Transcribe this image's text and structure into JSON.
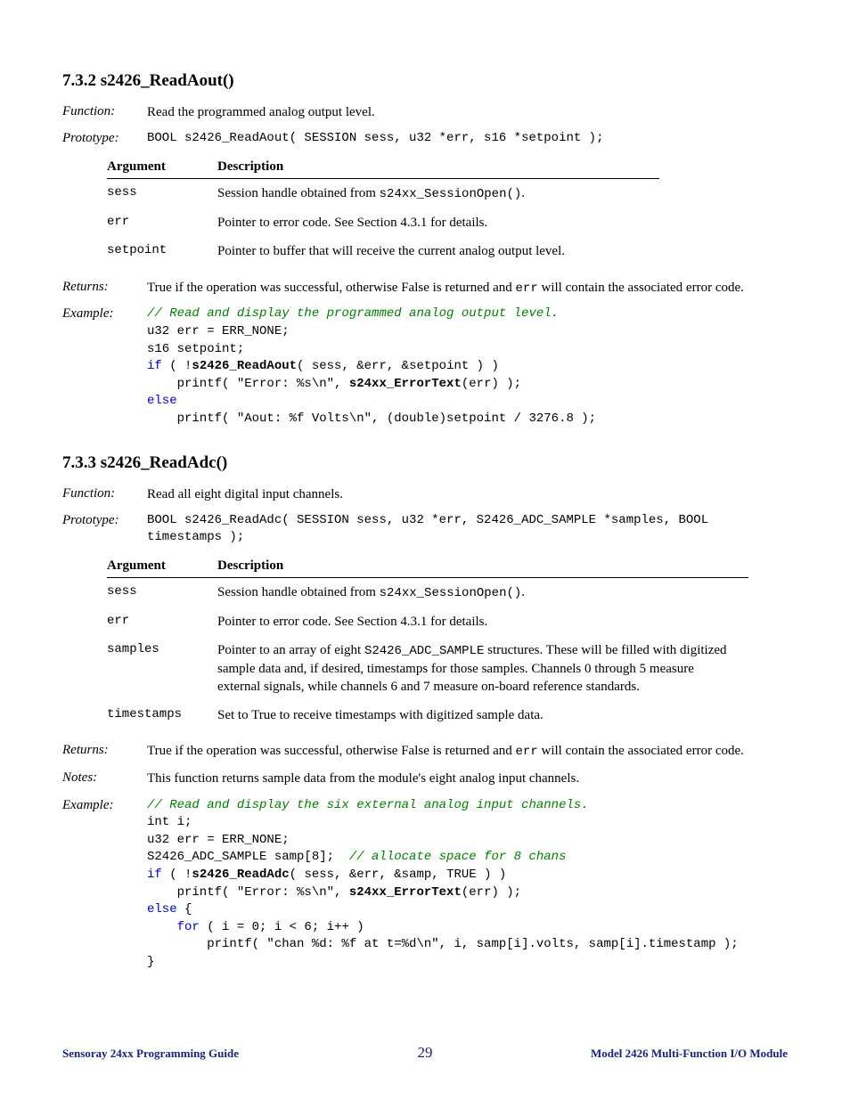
{
  "section732": {
    "heading": "7.3.2  s2426_ReadAout()",
    "function_label": "Function:",
    "function_text": "Read the programmed analog output level.",
    "prototype_label": "Prototype:",
    "prototype_text": "BOOL s2426_ReadAout( SESSION sess, u32 *err, s16 *setpoint );",
    "argtable": {
      "h_arg": "Argument",
      "h_desc": "Description",
      "rows": [
        {
          "arg": "sess",
          "desc_pre": "Session handle obtained from ",
          "desc_code": "s24xx_SessionOpen()",
          "desc_post": "."
        },
        {
          "arg": "err",
          "desc_pre": "Pointer to error code. See Section 4.3.1 for details.",
          "desc_code": "",
          "desc_post": ""
        },
        {
          "arg": "setpoint",
          "desc_pre": "Pointer to buffer that will receive the current analog output level.",
          "desc_code": "",
          "desc_post": ""
        }
      ]
    },
    "returns_label": "Returns:",
    "returns_pre": "True if the operation was successful, otherwise False is returned and ",
    "returns_code": "err",
    "returns_post": " will contain the associated error code.",
    "example_label": "Example:",
    "example": {
      "c1": "// Read and display the programmed analog output level.",
      "l1": "u32 err = ERR_NONE;",
      "l2": "s16 setpoint;",
      "l3_if": "if",
      "l3_rest_a": " ( !",
      "l3_fn": "s2426_ReadAout",
      "l3_rest_b": "( sess, &err, &setpoint ) )",
      "l4_a": "    printf( \"Error: %s\\n\", ",
      "l4_fn": "s24xx_ErrorText",
      "l4_b": "(err) );",
      "l5_else": "else",
      "l6": "    printf( \"Aout: %f Volts\\n\", (double)setpoint / 3276.8 );"
    }
  },
  "section733": {
    "heading": "7.3.3  s2426_ReadAdc()",
    "function_label": "Function:",
    "function_text": "Read all eight digital input channels.",
    "prototype_label": "Prototype:",
    "prototype_text": "BOOL s2426_ReadAdc( SESSION sess, u32 *err, S2426_ADC_SAMPLE *samples, BOOL timestamps );",
    "argtable": {
      "h_arg": "Argument",
      "h_desc": "Description",
      "rows": [
        {
          "arg": "sess",
          "desc_pre": "Session handle obtained from ",
          "desc_code": "s24xx_SessionOpen()",
          "desc_post": "."
        },
        {
          "arg": "err",
          "desc_pre": "Pointer to error code. See Section 4.3.1 for details.",
          "desc_code": "",
          "desc_post": ""
        },
        {
          "arg": "samples",
          "desc_pre": "Pointer to an array of eight ",
          "desc_code": "S2426_ADC_SAMPLE",
          "desc_post": " structures. These will be filled with digitized sample data and, if desired, timestamps for those samples. Channels 0 through 5 measure external signals, while channels 6 and 7 measure on-board reference standards."
        },
        {
          "arg": "timestamps",
          "desc_pre": "Set to True to receive timestamps with digitized sample data.",
          "desc_code": "",
          "desc_post": ""
        }
      ]
    },
    "returns_label": "Returns:",
    "returns_pre": "True if the operation was successful, otherwise False is returned and ",
    "returns_code": "err",
    "returns_post": " will contain the associated error code.",
    "notes_label": "Notes:",
    "notes_text": "This function returns sample data from the module's eight analog input channels.",
    "example_label": "Example:",
    "example": {
      "c1": "// Read and display the six external analog input channels.",
      "l1": "int i;",
      "l2": "u32 err = ERR_NONE;",
      "l3_a": "S2426_ADC_SAMPLE samp[8];  ",
      "l3_c": "// allocate space for 8 chans",
      "l4_if": "if",
      "l4_rest_a": " ( !",
      "l4_fn": "s2426_ReadAdc",
      "l4_rest_b": "( sess, &err, &samp, TRUE ) )",
      "l5_a": "    printf( \"Error: %s\\n\", ",
      "l5_fn": "s24xx_ErrorText",
      "l5_b": "(err) );",
      "l6_else": "else",
      "l6_rest": " {",
      "l7_for": "    for",
      "l7_rest": " ( i = 0; i < 6; i++ )",
      "l8": "        printf( \"chan %d: %f at t=%d\\n\", i, samp[i].volts, samp[i].timestamp );",
      "l9": "}"
    }
  },
  "footer": {
    "left": "Sensoray 24xx Programming Guide",
    "center": "29",
    "right": "Model 2426 Multi-Function I/O Module"
  }
}
